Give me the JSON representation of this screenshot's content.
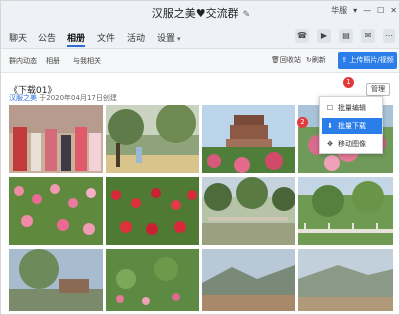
{
  "window": {
    "title": "汉服之美♥交流群",
    "edit_icon": "edit-icon",
    "controls": [
      "华服",
      "▾",
      "—",
      "☐",
      "✕"
    ]
  },
  "tabs": [
    {
      "label": "聊天",
      "active": false
    },
    {
      "label": "公告",
      "active": false
    },
    {
      "label": "相册",
      "active": true
    },
    {
      "label": "文件",
      "active": false
    },
    {
      "label": "活动",
      "active": false
    },
    {
      "label": "设置",
      "active": false
    }
  ],
  "tab_icons": [
    "phone-icon",
    "video-icon",
    "note-icon",
    "chat-icon",
    "more-icon"
  ],
  "subtabs": [
    "群内动态",
    "相册",
    "与我相关"
  ],
  "subactions": {
    "recycle": "回收站",
    "refresh": "刷新",
    "upload": "上传照片/视频"
  },
  "album": {
    "title": "《下载01》",
    "owner": "汉服之美",
    "created": "于2020年04月17日创建",
    "manage_label": "管理",
    "badge1": "1",
    "badge2": "2"
  },
  "menu": {
    "items": [
      {
        "label": "批量编辑",
        "icon": "edit-icon"
      },
      {
        "label": "批量下载",
        "icon": "download-icon",
        "highlighted": true
      },
      {
        "label": "移动图像",
        "icon": "move-icon"
      }
    ]
  },
  "colors": {
    "accent": "#2b7de9",
    "badge": "#e23a3a"
  }
}
